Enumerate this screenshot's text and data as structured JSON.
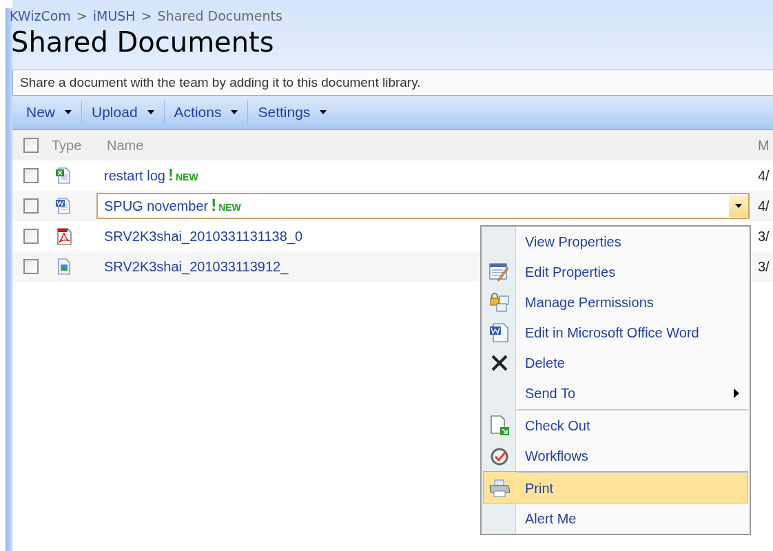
{
  "breadcrumb": [
    {
      "label": "KWizCom",
      "link": true
    },
    {
      "label": "iMUSH",
      "link": true
    },
    {
      "label": "Shared Documents",
      "link": false
    }
  ],
  "separator": ">",
  "title": "Shared Documents",
  "description": "Share a document with the team by adding it to this document library.",
  "toolbar": [
    {
      "label": "New"
    },
    {
      "label": "Upload"
    },
    {
      "label": "Actions"
    },
    {
      "label": "Settings"
    }
  ],
  "table": {
    "select_all": {
      "checked": false
    },
    "columns": [
      "Type",
      "Name",
      "M"
    ],
    "rows": [
      {
        "checked": false,
        "kind": "excel",
        "name": "restart log",
        "new": true,
        "new_label": "NEW",
        "focused": false,
        "column_3": "4/"
      },
      {
        "checked": false,
        "kind": "word",
        "name": "SPUG november",
        "new": true,
        "new_label": "NEW",
        "focused": true,
        "column_3": "4/"
      },
      {
        "checked": false,
        "kind": "pdf",
        "name": "SRV2K3shai_2010331131138_0",
        "new": false,
        "focused": false,
        "column_3": "3/"
      },
      {
        "checked": false,
        "kind": "image",
        "name": "SRV2K3shai_201033113912_",
        "new": false,
        "focused": false,
        "column_3": "3/"
      }
    ]
  },
  "new_mark": "!",
  "context_menu": [
    {
      "label": "View Properties",
      "kind": "none",
      "separator_before": false,
      "submenu": false,
      "selected": false
    },
    {
      "label": "Edit Properties",
      "kind": "edit",
      "separator_before": false,
      "submenu": false,
      "selected": false
    },
    {
      "label": "Manage Permissions",
      "kind": "permissions",
      "separator_before": false,
      "submenu": false,
      "selected": false
    },
    {
      "label": "Edit in Microsoft Office Word",
      "kind": "word",
      "separator_before": false,
      "submenu": false,
      "selected": false
    },
    {
      "label": "Delete",
      "kind": "delete",
      "separator_before": false,
      "submenu": false,
      "selected": false
    },
    {
      "label": "Send To",
      "kind": "none",
      "separator_before": false,
      "submenu": true,
      "selected": false
    },
    {
      "label": "Check Out",
      "kind": "checkout",
      "separator_before": true,
      "submenu": false,
      "selected": false
    },
    {
      "label": "Workflows",
      "kind": "workflow",
      "separator_before": false,
      "submenu": false,
      "selected": false
    },
    {
      "label": "Print",
      "kind": "print",
      "separator_before": true,
      "submenu": false,
      "selected": true
    },
    {
      "label": "Alert Me",
      "kind": "none",
      "separator_before": false,
      "submenu": false,
      "selected": false
    }
  ]
}
